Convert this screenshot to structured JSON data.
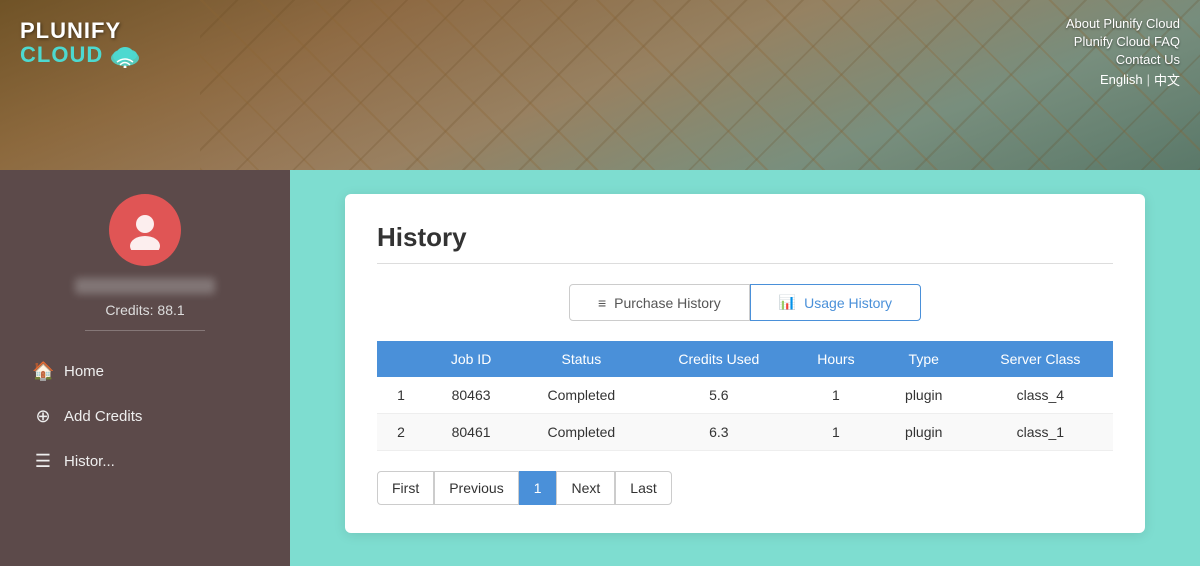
{
  "header": {
    "logo_plunify": "PLUNIFY",
    "logo_cloud": "CLOUD",
    "nav_links": [
      {
        "label": "About Plunify Cloud",
        "key": "about"
      },
      {
        "label": "Plunify Cloud FAQ",
        "key": "faq"
      },
      {
        "label": "Contact Us",
        "key": "contact"
      }
    ],
    "lang_english": "English",
    "lang_separator": "|",
    "lang_chinese": "中文"
  },
  "sidebar": {
    "credits_label": "Credits: 88.1",
    "nav_items": [
      {
        "label": "Home",
        "icon": "🏠",
        "key": "home"
      },
      {
        "label": "Add Credits",
        "icon": "⊕",
        "key": "add-credits"
      },
      {
        "label": "Histor...",
        "icon": "☰",
        "key": "history"
      }
    ]
  },
  "main": {
    "page_title": "History",
    "tabs": [
      {
        "label": "Purchase History",
        "key": "purchase",
        "icon": "≡",
        "active": false
      },
      {
        "label": "Usage History",
        "key": "usage",
        "icon": "📊",
        "active": true
      }
    ],
    "table": {
      "columns": [
        "",
        "Job ID",
        "Status",
        "Credits Used",
        "Hours",
        "Type",
        "Server Class"
      ],
      "rows": [
        {
          "row_num": "1",
          "job_id": "80463",
          "status": "Completed",
          "credits_used": "5.6",
          "hours": "1",
          "type": "plugin",
          "server_class": "class_4",
          "hours_red": true
        },
        {
          "row_num": "2",
          "job_id": "80461",
          "status": "Completed",
          "credits_used": "6.3",
          "hours": "1",
          "type": "plugin",
          "server_class": "class_1",
          "hours_red": true
        }
      ]
    },
    "pagination": [
      {
        "label": "First",
        "key": "first",
        "active": false
      },
      {
        "label": "Previous",
        "key": "previous",
        "active": false
      },
      {
        "label": "1",
        "key": "1",
        "active": true
      },
      {
        "label": "Next",
        "key": "next",
        "active": false
      },
      {
        "label": "Last",
        "key": "last",
        "active": false
      }
    ]
  }
}
